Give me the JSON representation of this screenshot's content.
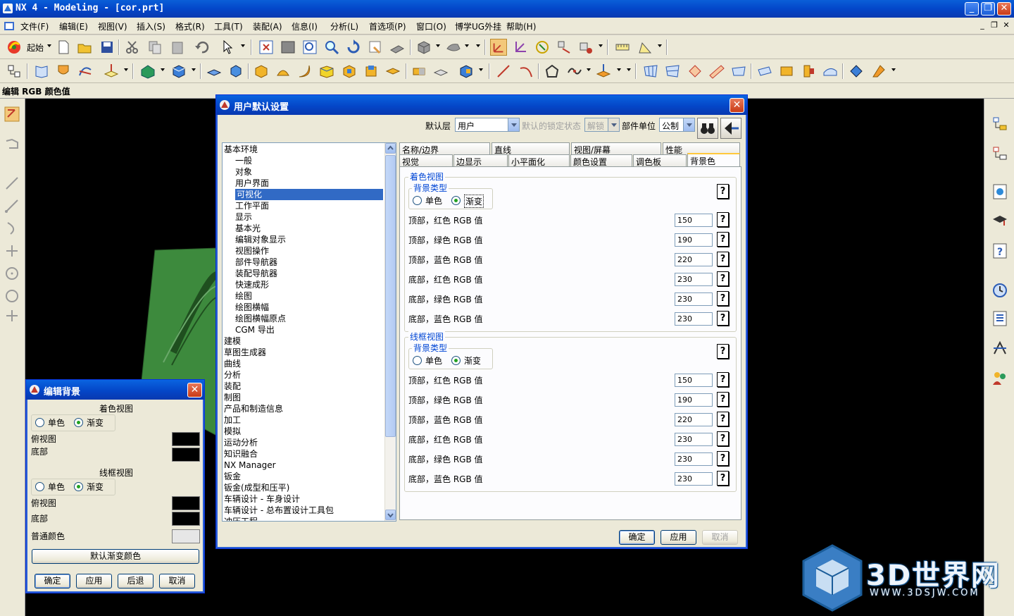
{
  "window": {
    "title": "NX 4 - Modeling - [cor.prt]"
  },
  "menu": [
    "文件(F)",
    "编辑(E)",
    "视图(V)",
    "插入(S)",
    "格式(R)",
    "工具(T)",
    "装配(A)",
    "信息(I)",
    "分析(L)",
    "首选项(P)",
    "窗口(O)",
    "博学UG外挂",
    "帮助(H)"
  ],
  "toolbar": {
    "start_label": "起始"
  },
  "status_line": "编辑 RGB 颜色值",
  "user_defaults": {
    "title": "用户默认设置",
    "level_label": "默认层",
    "level_value": "用户",
    "lock_label": "默认的锁定状态",
    "lock_value": "解锁",
    "unit_label": "部件单位",
    "unit_value": "公制",
    "tree": [
      {
        "label": "基本环境",
        "indent": 0
      },
      {
        "label": "一般",
        "indent": 1
      },
      {
        "label": "对象",
        "indent": 1
      },
      {
        "label": "用户界面",
        "indent": 1
      },
      {
        "label": "可视化",
        "indent": 1,
        "selected": true
      },
      {
        "label": "工作平面",
        "indent": 1
      },
      {
        "label": "显示",
        "indent": 1
      },
      {
        "label": "基本光",
        "indent": 1
      },
      {
        "label": "编辑对象显示",
        "indent": 1
      },
      {
        "label": "视图操作",
        "indent": 1
      },
      {
        "label": "部件导航器",
        "indent": 1
      },
      {
        "label": "装配导航器",
        "indent": 1
      },
      {
        "label": "快速成形",
        "indent": 1
      },
      {
        "label": "绘图",
        "indent": 1
      },
      {
        "label": "绘图横幅",
        "indent": 1
      },
      {
        "label": "绘图横幅原点",
        "indent": 1
      },
      {
        "label": "CGM 导出",
        "indent": 1
      },
      {
        "label": "建模",
        "indent": 0
      },
      {
        "label": "草图生成器",
        "indent": 0
      },
      {
        "label": "曲线",
        "indent": 0
      },
      {
        "label": "分析",
        "indent": 0
      },
      {
        "label": "装配",
        "indent": 0
      },
      {
        "label": "制图",
        "indent": 0
      },
      {
        "label": "产品和制造信息",
        "indent": 0
      },
      {
        "label": "加工",
        "indent": 0
      },
      {
        "label": "模拟",
        "indent": 0
      },
      {
        "label": "运动分析",
        "indent": 0
      },
      {
        "label": "知识融合",
        "indent": 0
      },
      {
        "label": "NX Manager",
        "indent": 0
      },
      {
        "label": "钣金",
        "indent": 0
      },
      {
        "label": "钣金(成型和压平)",
        "indent": 0
      },
      {
        "label": "车辆设计 - 车身设计",
        "indent": 0
      },
      {
        "label": "车辆设计 - 总布置设计工具包",
        "indent": 0
      },
      {
        "label": "冲压工程",
        "indent": 0
      }
    ],
    "tabs_row1": [
      "名称/边界",
      "直线",
      "视图/屏幕",
      "性能"
    ],
    "tabs_row2": [
      "视觉",
      "边显示",
      "小平面化",
      "颜色设置",
      "调色板",
      "背景色"
    ],
    "active_tab": "背景色",
    "shaded": {
      "group_title": "着色视图",
      "bg_type_label": "背景类型",
      "opt_single": "单色",
      "opt_gradient": "渐变",
      "rows": [
        {
          "label": "顶部，红色 RGB 值",
          "value": "150"
        },
        {
          "label": "顶部，绿色 RGB 值",
          "value": "190"
        },
        {
          "label": "顶部，蓝色 RGB 值",
          "value": "220"
        },
        {
          "label": "底部，红色 RGB 值",
          "value": "230"
        },
        {
          "label": "底部，绿色 RGB 值",
          "value": "230"
        },
        {
          "label": "底部，蓝色 RGB 值",
          "value": "230"
        }
      ]
    },
    "wireframe": {
      "group_title": "线框视图",
      "bg_type_label": "背景类型",
      "opt_single": "单色",
      "opt_gradient": "渐变",
      "rows": [
        {
          "label": "顶部，红色 RGB 值",
          "value": "150"
        },
        {
          "label": "顶部，绿色 RGB 值",
          "value": "190"
        },
        {
          "label": "顶部，蓝色 RGB 值",
          "value": "220"
        },
        {
          "label": "底部，红色 RGB 值",
          "value": "230"
        },
        {
          "label": "底部，绿色 RGB 值",
          "value": "230"
        },
        {
          "label": "底部，蓝色 RGB 值",
          "value": "230"
        }
      ]
    },
    "help_glyph": "?",
    "ok": "确定",
    "apply": "应用",
    "cancel": "取消"
  },
  "edit_background": {
    "title": "编辑背景",
    "shaded_title": "着色视图",
    "wire_title": "线框视图",
    "opt_single": "单色",
    "opt_gradient": "渐变",
    "top_label": "俯视图",
    "bottom_label": "底部",
    "plain_color_label": "普通颜色",
    "default_gradient_button": "默认渐变颜色",
    "ok": "确定",
    "apply": "应用",
    "back": "后退",
    "cancel": "取消"
  },
  "watermark": {
    "text": "3D世界网",
    "url": "WWW.3DSJW.COM"
  },
  "colors": {
    "titlebar": "#0a5fd8",
    "graphics_bg": "#000000",
    "part_green": "#3d8a3d",
    "selection": "#316ac5"
  }
}
